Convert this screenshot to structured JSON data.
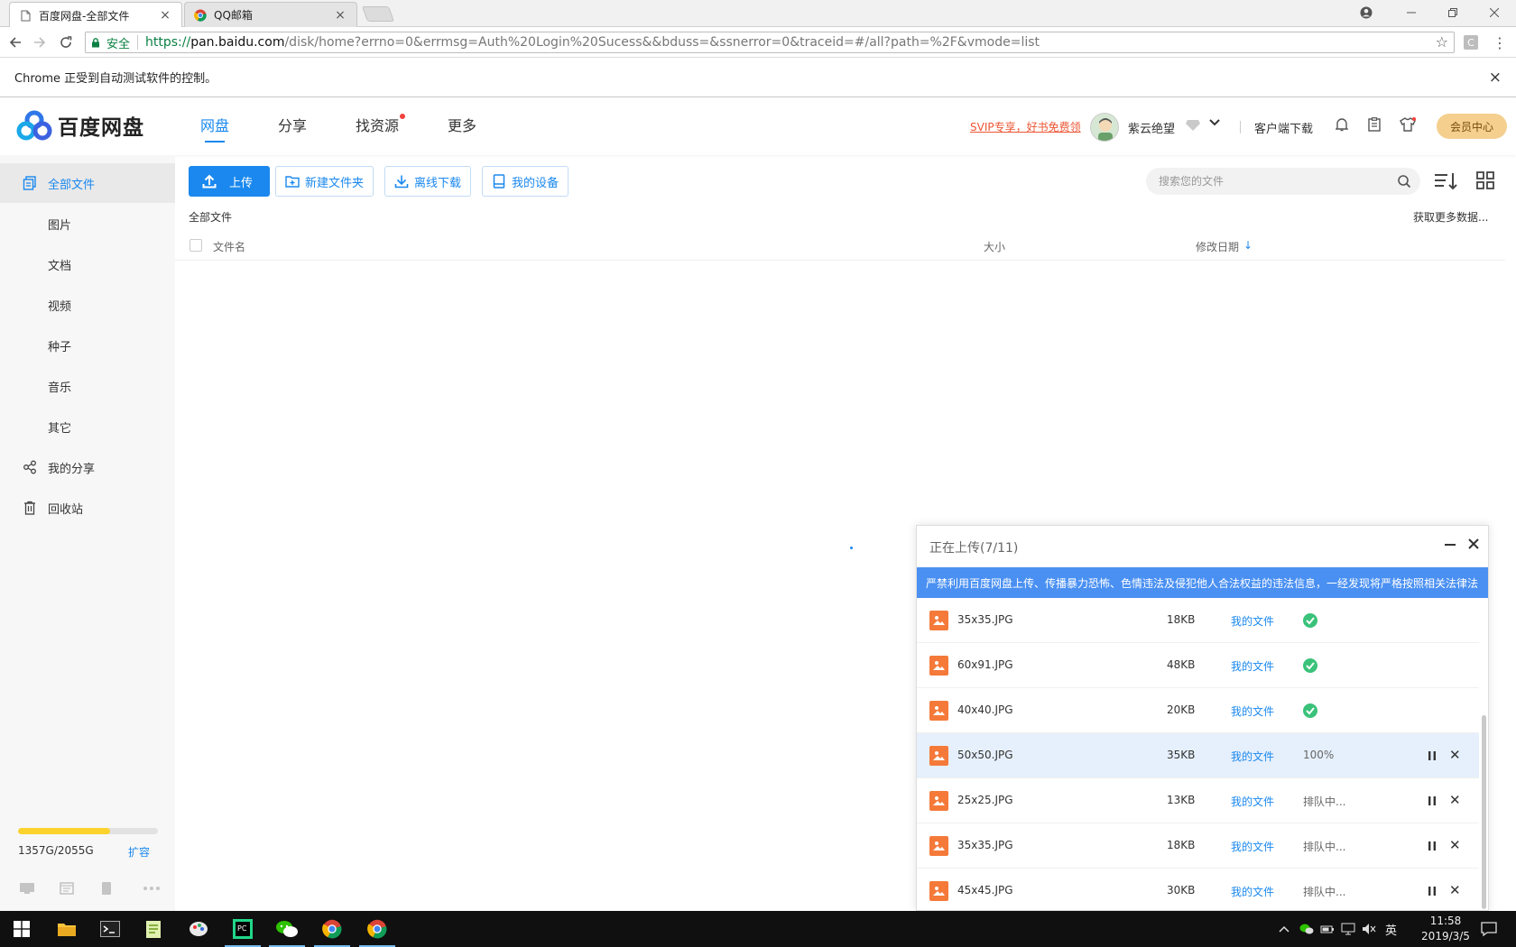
{
  "browser": {
    "tabs": [
      {
        "title": "百度网盘-全部文件",
        "close": "×"
      },
      {
        "title": "QQ邮箱",
        "close": "×"
      }
    ],
    "address": {
      "secure_label": "安全",
      "scheme": "https://",
      "host": "pan.baidu.com",
      "path": "/disk/home?errno=0&errmsg=Auth%20Login%20Sucess&&bduss=&ssnerror=0&traceid=#/all?path=%2F&vmode=list"
    },
    "automation_notice": "Chrome 正受到自动测试软件的控制。",
    "notice_close": "×"
  },
  "header": {
    "logo_text": "百度网盘",
    "nav": [
      "网盘",
      "分享",
      "找资源",
      "更多"
    ],
    "svip_promo": "SVIP专享，好书免费领",
    "username": "紫云绝望",
    "client_download": "客户端下载",
    "member_center": "会员中心"
  },
  "sidebar": {
    "items": [
      "全部文件",
      "图片",
      "文档",
      "视频",
      "种子",
      "音乐",
      "其它",
      "我的分享",
      "回收站"
    ],
    "quota_text": "1357G/2055G",
    "quota_used_fraction": 0.66,
    "expand_label": "扩容"
  },
  "toolbar": {
    "upload": "上传",
    "new_folder": "新建文件夹",
    "offline_download": "离线下载",
    "my_devices": "我的设备",
    "search_placeholder": "搜索您的文件"
  },
  "filelist": {
    "breadcrumb": "全部文件",
    "more_data": "获取更多数据...",
    "columns": {
      "name": "文件名",
      "size": "大小",
      "modified": "修改日期"
    },
    "sort_indicator": "↓"
  },
  "upload_panel": {
    "title": "正在上传(7/11)",
    "warning": "严禁利用百度网盘上传、传播暴力恐怖、色情违法及侵犯他人合法权益的违法信息，一经发现将严格按照相关法律法",
    "items": [
      {
        "name": "35x35.JPG",
        "size": "18KB",
        "dest": "我的文件",
        "status": "",
        "state": "done"
      },
      {
        "name": "60x91.JPG",
        "size": "48KB",
        "dest": "我的文件",
        "status": "",
        "state": "done"
      },
      {
        "name": "40x40.JPG",
        "size": "20KB",
        "dest": "我的文件",
        "status": "",
        "state": "done"
      },
      {
        "name": "50x50.JPG",
        "size": "35KB",
        "dest": "我的文件",
        "status": "100%",
        "state": "uploading"
      },
      {
        "name": "25x25.JPG",
        "size": "13KB",
        "dest": "我的文件",
        "status": "排队中...",
        "state": "queued"
      },
      {
        "name": "35x35.JPG",
        "size": "18KB",
        "dest": "我的文件",
        "status": "排队中...",
        "state": "queued"
      },
      {
        "name": "45x45.JPG",
        "size": "30KB",
        "dest": "我的文件",
        "status": "排队中...",
        "state": "queued"
      }
    ]
  },
  "taskbar": {
    "lang": "英",
    "time": "11:58",
    "date": "2019/3/5"
  },
  "colors": {
    "accent": "#1a88ee",
    "warning_bar": "#4a90f2",
    "quota_fill": "#fcd22d",
    "member_btn": "#f4cf8e",
    "file_icon": "#f57a3a",
    "success": "#3ac27a",
    "svip_red": "#e53"
  }
}
